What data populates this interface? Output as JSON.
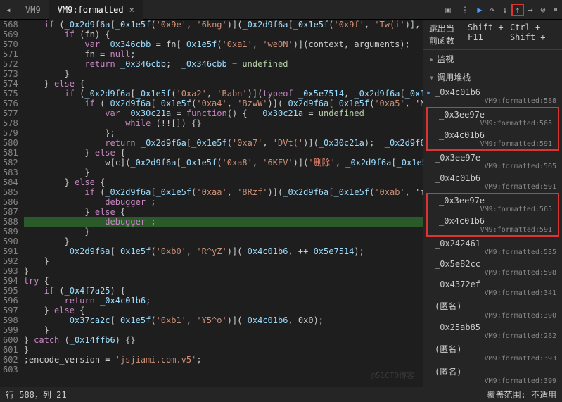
{
  "tabs": {
    "t1": "VM9",
    "t2": "VM9:formatted"
  },
  "toolbar": {
    "play": "▶",
    "step_over": "↷",
    "step_into": "↓",
    "step_out": "↑",
    "more": "⋯",
    "deact": "⊘",
    "pause": "⏸"
  },
  "shortcut": {
    "label": "跳出当前函数",
    "k1": "Shift + F11",
    "k2": "Ctrl + Shift +"
  },
  "sections": {
    "watch": "监视",
    "callstack": "调用堆栈"
  },
  "gutter_start": 568,
  "gutter_end": 603,
  "code": [
    "    if (_0x2d9f6a[_0x1e5f('0x9e', '6kng')](_0x2d9f6a[_0x1e5f('0x9f', 'Tw(i')],",
    "        if (fn) {",
    "            var _0x346cbb = fn[_0x1e5f('0xa1', 'weON')](context, arguments); ",
    "            fn = null;",
    "            return _0x346cbb;  _0x346cbb = undefined",
    "        }",
    "    } else {",
    "        if (_0x2d9f6a[_0x1e5f('0xa2', 'Babn')](typeof _0x5e7514, _0x2d9f6a[_0x1e",
    "            if (_0x2d9f6a[_0x1e5f('0xa4', 'BzwW')](_0x2d9f6a[_0x1e5f('0xa5', 'NF",
    "                var _0x30c21a = function() {  _0x30c21a = undefined",
    "                    while (!![]) {}",
    "                };",
    "                return _0x2d9f6a[_0x1e5f('0xa7', 'DVt(')](_0x30c21a);  _0x2d9f6",
    "            } else {",
    "                w[c](_0x2d9f6a[_0x1e5f('0xa8', '6KEV')]('删除', _0x2d9f6a[_0x1e5",
    "            }",
    "        } else {",
    "            if (_0x2d9f6a[_0x1e5f('0xaa', '8Rzf')](_0x2d9f6a[_0x1e5f('0xab', 'mo",
    "                debugger ;",
    "            } else {",
    "                debugger ;",
    "            }",
    "        }",
    "        _0x2d9f6a[_0x1e5f('0xb0', 'R^yZ')](_0x4c01b6, ++_0x5e7514);",
    "    }",
    "}",
    "try {",
    "    if (_0x4f7a25) {",
    "        return _0x4c01b6;",
    "    } else {",
    "        _0x37ca2c[_0x1e5f('0xb1', 'Y5^o')](_0x4c01b6, 0x0);",
    "    }",
    "} catch (_0x14ffb6) {}",
    "}",
    ";encode_version = 'jsjiami.com.v5';",
    ""
  ],
  "highlight_line": 588,
  "stack": [
    {
      "fn": "_0x4c01b6",
      "loc": "VM9:formatted:588",
      "arrow": true
    },
    {
      "fn": "_0x3ee97e",
      "loc": "VM9:formatted:565",
      "box": "start"
    },
    {
      "fn": "_0x4c01b6",
      "loc": "VM9:formatted:591",
      "box": "end"
    },
    {
      "fn": "_0x3ee97e",
      "loc": "VM9:formatted:565"
    },
    {
      "fn": "_0x4c01b6",
      "loc": "VM9:formatted:591"
    },
    {
      "fn": "_0x3ee97e",
      "loc": "VM9:formatted:565",
      "box": "start"
    },
    {
      "fn": "_0x4c01b6",
      "loc": "VM9:formatted:591",
      "box": "end"
    },
    {
      "fn": "_0x242461",
      "loc": "VM9:formatted:535"
    },
    {
      "fn": "_0x5e82cc",
      "loc": "VM9:formatted:598"
    },
    {
      "fn": "_0x4372ef",
      "loc": "VM9:formatted:341"
    },
    {
      "fn": "(匿名)",
      "loc": "VM9:formatted:390"
    },
    {
      "fn": "_0x25ab85",
      "loc": "VM9:formatted:282"
    },
    {
      "fn": "(匿名)",
      "loc": "VM9:formatted:393"
    },
    {
      "fn": "(匿名)",
      "loc": "VM9:formatted:399"
    }
  ],
  "status": {
    "pos": "行 588，列 21",
    "coverage": "覆盖范围: 不适用"
  },
  "watermark": "@51CTO博客"
}
